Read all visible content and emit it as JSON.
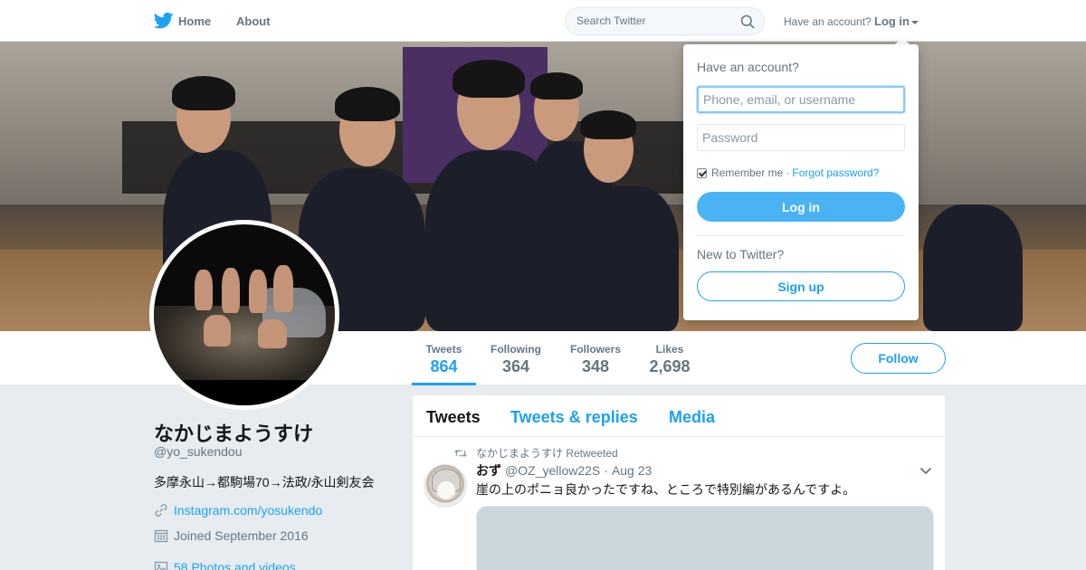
{
  "nav": {
    "brand_icon": "twitter-bird-icon",
    "home_label": "Home",
    "about_label": "About",
    "search_placeholder": "Search Twitter",
    "have_account": "Have an account?",
    "login_label": "Log in"
  },
  "profile": {
    "name": "なかじまようすけ",
    "handle": "@yo_sukendou",
    "bio": "多摩永山→都駒場70→法政/永山剣友会",
    "link": "Instagram.com/yosukendo",
    "joined": "Joined September 2016",
    "photos": "58 Photos and videos",
    "follow_label": "Follow"
  },
  "stats": [
    {
      "label": "Tweets",
      "value": "864",
      "active": true
    },
    {
      "label": "Following",
      "value": "364",
      "active": false
    },
    {
      "label": "Followers",
      "value": "348",
      "active": false
    },
    {
      "label": "Likes",
      "value": "2,698",
      "active": false
    }
  ],
  "timeline": {
    "tabs": [
      {
        "label": "Tweets",
        "active": true
      },
      {
        "label": "Tweets & replies",
        "active": false
      },
      {
        "label": "Media",
        "active": false
      }
    ],
    "tweet": {
      "retweet_text": "なかじまようすけ Retweeted",
      "author_name": "おず",
      "author_handle": "@OZ_yellow22S",
      "separator": "·",
      "date": "Aug 23",
      "text": "崖の上のポニョ良かったですね、ところで特別編があるんですよ。"
    }
  },
  "login_dropdown": {
    "title": "Have an account?",
    "username_placeholder": "Phone, email, or username",
    "password_placeholder": "Password",
    "remember_label": "Remember me",
    "separator": "·",
    "forgot_label": "Forgot password?",
    "login_button": "Log in",
    "new_label": "New to Twitter?",
    "signup_button": "Sign up"
  },
  "colors": {
    "accent": "#1da1f2",
    "login_button": "#4ab3f4",
    "page_background": "#e6ecf0"
  }
}
